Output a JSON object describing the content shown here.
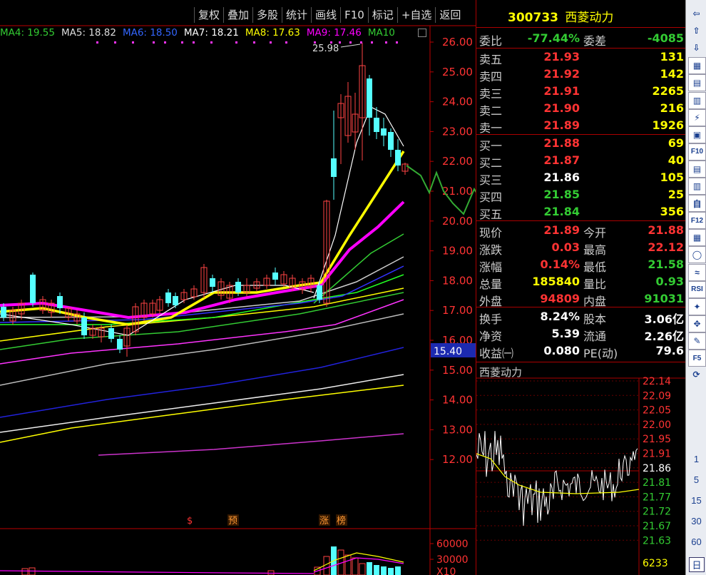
{
  "toolbar": [
    "复权",
    "叠加",
    "多股",
    "统计",
    "画线",
    "F10",
    "标记",
    "+自选",
    "返回"
  ],
  "ma_legend": [
    {
      "label": "MA4: 19.55",
      "color": "#3c3"
    },
    {
      "label": "MA5: 18.82",
      "color": "#ddd"
    },
    {
      "label": "MA6: 18.50",
      "color": "#36f"
    },
    {
      "label": "MA7: 18.21",
      "color": "#fff"
    },
    {
      "label": "MA8: 17.63",
      "color": "#ff0"
    },
    {
      "label": "MA9: 17.46",
      "color": "#f0f"
    },
    {
      "label": "MA10",
      "color": "#3c3"
    }
  ],
  "price_axis": [
    "26.00",
    "25.00",
    "24.00",
    "23.00",
    "22.00",
    "21.00",
    "20.00",
    "19.00",
    "18.00",
    "17.00",
    "16.00",
    "15.00",
    "14.00",
    "13.00",
    "12.00"
  ],
  "current_price_tag": "15.40",
  "high_label": "25.98",
  "markers": [
    {
      "label": "$",
      "color": "#f33"
    },
    {
      "label": "预",
      "color": "#f93"
    },
    {
      "label": "涨",
      "color": "#f93"
    },
    {
      "label": "榜",
      "color": "#f93"
    }
  ],
  "volume_axis": [
    "60000",
    "30000",
    "X10"
  ],
  "quote": {
    "code": "300733",
    "name": "西菱动力",
    "wei_bi": {
      "label": "委比",
      "value": "-77.44%",
      "label2": "委差",
      "value2": "-4085"
    },
    "asks": [
      {
        "label": "卖五",
        "price": "21.93",
        "vol": "131"
      },
      {
        "label": "卖四",
        "price": "21.92",
        "vol": "142"
      },
      {
        "label": "卖三",
        "price": "21.91",
        "vol": "2265"
      },
      {
        "label": "卖二",
        "price": "21.90",
        "vol": "216"
      },
      {
        "label": "卖一",
        "price": "21.89",
        "vol": "1926"
      }
    ],
    "bids": [
      {
        "label": "买一",
        "price": "21.88",
        "vol": "69",
        "pcolor": "#f33"
      },
      {
        "label": "买二",
        "price": "21.87",
        "vol": "40",
        "pcolor": "#f33"
      },
      {
        "label": "买三",
        "price": "21.86",
        "vol": "105",
        "pcolor": "#fff"
      },
      {
        "label": "买四",
        "price": "21.85",
        "vol": "25",
        "pcolor": "#3c3"
      },
      {
        "label": "买五",
        "price": "21.84",
        "vol": "356",
        "pcolor": "#3c3"
      }
    ],
    "stats1": [
      {
        "l1": "现价",
        "v1": "21.89",
        "c1": "#f33",
        "l2": "今开",
        "v2": "21.88",
        "c2": "#f33"
      },
      {
        "l1": "涨跌",
        "v1": "0.03",
        "c1": "#f33",
        "l2": "最高",
        "v2": "22.12",
        "c2": "#f33"
      },
      {
        "l1": "涨幅",
        "v1": "0.14%",
        "c1": "#f33",
        "l2": "最低",
        "v2": "21.58",
        "c2": "#3c3"
      },
      {
        "l1": "总量",
        "v1": "185840",
        "c1": "#ff0",
        "l2": "量比",
        "v2": "0.93",
        "c2": "#3c3"
      },
      {
        "l1": "外盘",
        "v1": "94809",
        "c1": "#f33",
        "l2": "内盘",
        "v2": "91031",
        "c2": "#3c3"
      }
    ],
    "stats2": [
      {
        "l1": "换手",
        "v1": "8.24%",
        "l2": "股本",
        "v2": "3.06亿"
      },
      {
        "l1": "净资",
        "v1": "5.39",
        "l2": "流通",
        "v2": "2.26亿"
      },
      {
        "l1": "收益㈠",
        "v1": "0.080",
        "l2": "PE(动)",
        "v2": "79.6"
      }
    ]
  },
  "mini_chart": {
    "title": "西菱动力",
    "axis": [
      "22.14",
      "22.09",
      "22.05",
      "22.00",
      "21.95",
      "21.91",
      "21.86",
      "21.81",
      "21.77",
      "21.72",
      "21.67",
      "21.63"
    ],
    "axis_colors": [
      "#f33",
      "#f33",
      "#f33",
      "#f33",
      "#f33",
      "#f33",
      "#fff",
      "#3c3",
      "#3c3",
      "#3c3",
      "#3c3",
      "#3c3"
    ],
    "bottom_vol": "6233"
  },
  "right_toolbar_numbers": [
    "1",
    "5",
    "15",
    "30",
    "60",
    "日"
  ]
}
